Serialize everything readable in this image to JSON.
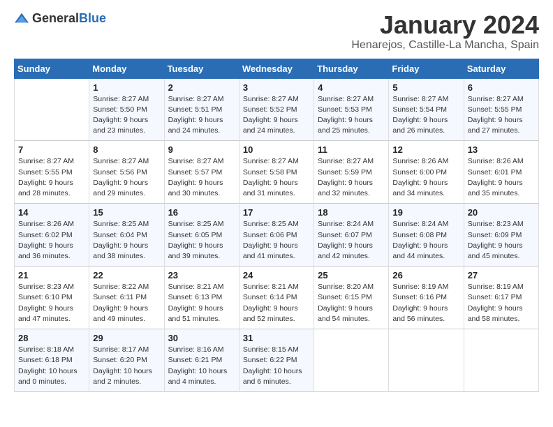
{
  "header": {
    "logo_general": "General",
    "logo_blue": "Blue",
    "month_title": "January 2024",
    "location": "Henarejos, Castille-La Mancha, Spain"
  },
  "days_of_week": [
    "Sunday",
    "Monday",
    "Tuesday",
    "Wednesday",
    "Thursday",
    "Friday",
    "Saturday"
  ],
  "weeks": [
    [
      {
        "day": "",
        "info": ""
      },
      {
        "day": "1",
        "info": "Sunrise: 8:27 AM\nSunset: 5:50 PM\nDaylight: 9 hours\nand 23 minutes."
      },
      {
        "day": "2",
        "info": "Sunrise: 8:27 AM\nSunset: 5:51 PM\nDaylight: 9 hours\nand 24 minutes."
      },
      {
        "day": "3",
        "info": "Sunrise: 8:27 AM\nSunset: 5:52 PM\nDaylight: 9 hours\nand 24 minutes."
      },
      {
        "day": "4",
        "info": "Sunrise: 8:27 AM\nSunset: 5:53 PM\nDaylight: 9 hours\nand 25 minutes."
      },
      {
        "day": "5",
        "info": "Sunrise: 8:27 AM\nSunset: 5:54 PM\nDaylight: 9 hours\nand 26 minutes."
      },
      {
        "day": "6",
        "info": "Sunrise: 8:27 AM\nSunset: 5:55 PM\nDaylight: 9 hours\nand 27 minutes."
      }
    ],
    [
      {
        "day": "7",
        "info": "Sunrise: 8:27 AM\nSunset: 5:55 PM\nDaylight: 9 hours\nand 28 minutes."
      },
      {
        "day": "8",
        "info": "Sunrise: 8:27 AM\nSunset: 5:56 PM\nDaylight: 9 hours\nand 29 minutes."
      },
      {
        "day": "9",
        "info": "Sunrise: 8:27 AM\nSunset: 5:57 PM\nDaylight: 9 hours\nand 30 minutes."
      },
      {
        "day": "10",
        "info": "Sunrise: 8:27 AM\nSunset: 5:58 PM\nDaylight: 9 hours\nand 31 minutes."
      },
      {
        "day": "11",
        "info": "Sunrise: 8:27 AM\nSunset: 5:59 PM\nDaylight: 9 hours\nand 32 minutes."
      },
      {
        "day": "12",
        "info": "Sunrise: 8:26 AM\nSunset: 6:00 PM\nDaylight: 9 hours\nand 34 minutes."
      },
      {
        "day": "13",
        "info": "Sunrise: 8:26 AM\nSunset: 6:01 PM\nDaylight: 9 hours\nand 35 minutes."
      }
    ],
    [
      {
        "day": "14",
        "info": "Sunrise: 8:26 AM\nSunset: 6:02 PM\nDaylight: 9 hours\nand 36 minutes."
      },
      {
        "day": "15",
        "info": "Sunrise: 8:25 AM\nSunset: 6:04 PM\nDaylight: 9 hours\nand 38 minutes."
      },
      {
        "day": "16",
        "info": "Sunrise: 8:25 AM\nSunset: 6:05 PM\nDaylight: 9 hours\nand 39 minutes."
      },
      {
        "day": "17",
        "info": "Sunrise: 8:25 AM\nSunset: 6:06 PM\nDaylight: 9 hours\nand 41 minutes."
      },
      {
        "day": "18",
        "info": "Sunrise: 8:24 AM\nSunset: 6:07 PM\nDaylight: 9 hours\nand 42 minutes."
      },
      {
        "day": "19",
        "info": "Sunrise: 8:24 AM\nSunset: 6:08 PM\nDaylight: 9 hours\nand 44 minutes."
      },
      {
        "day": "20",
        "info": "Sunrise: 8:23 AM\nSunset: 6:09 PM\nDaylight: 9 hours\nand 45 minutes."
      }
    ],
    [
      {
        "day": "21",
        "info": "Sunrise: 8:23 AM\nSunset: 6:10 PM\nDaylight: 9 hours\nand 47 minutes."
      },
      {
        "day": "22",
        "info": "Sunrise: 8:22 AM\nSunset: 6:11 PM\nDaylight: 9 hours\nand 49 minutes."
      },
      {
        "day": "23",
        "info": "Sunrise: 8:21 AM\nSunset: 6:13 PM\nDaylight: 9 hours\nand 51 minutes."
      },
      {
        "day": "24",
        "info": "Sunrise: 8:21 AM\nSunset: 6:14 PM\nDaylight: 9 hours\nand 52 minutes."
      },
      {
        "day": "25",
        "info": "Sunrise: 8:20 AM\nSunset: 6:15 PM\nDaylight: 9 hours\nand 54 minutes."
      },
      {
        "day": "26",
        "info": "Sunrise: 8:19 AM\nSunset: 6:16 PM\nDaylight: 9 hours\nand 56 minutes."
      },
      {
        "day": "27",
        "info": "Sunrise: 8:19 AM\nSunset: 6:17 PM\nDaylight: 9 hours\nand 58 minutes."
      }
    ],
    [
      {
        "day": "28",
        "info": "Sunrise: 8:18 AM\nSunset: 6:18 PM\nDaylight: 10 hours\nand 0 minutes."
      },
      {
        "day": "29",
        "info": "Sunrise: 8:17 AM\nSunset: 6:20 PM\nDaylight: 10 hours\nand 2 minutes."
      },
      {
        "day": "30",
        "info": "Sunrise: 8:16 AM\nSunset: 6:21 PM\nDaylight: 10 hours\nand 4 minutes."
      },
      {
        "day": "31",
        "info": "Sunrise: 8:15 AM\nSunset: 6:22 PM\nDaylight: 10 hours\nand 6 minutes."
      },
      {
        "day": "",
        "info": ""
      },
      {
        "day": "",
        "info": ""
      },
      {
        "day": "",
        "info": ""
      }
    ]
  ]
}
